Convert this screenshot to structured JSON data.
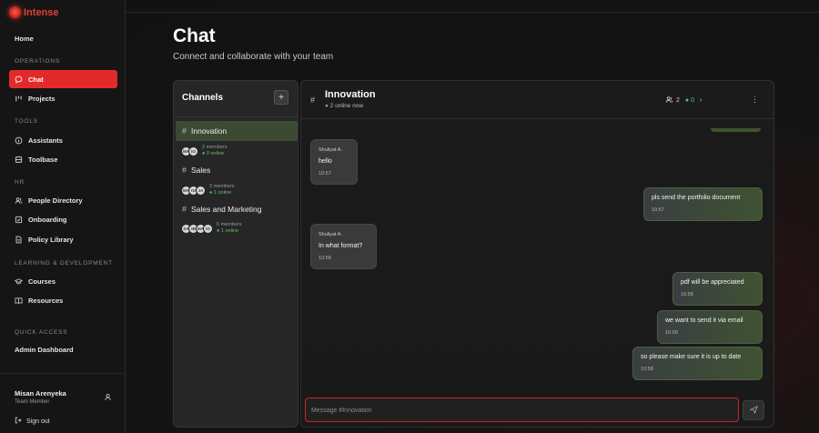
{
  "brand": {
    "name": "Intense"
  },
  "sidebar": {
    "home": "Home",
    "sections": [
      {
        "title": "OPERATIONS",
        "items": [
          {
            "label": "Chat",
            "icon": "chat-bubble-icon"
          },
          {
            "label": "Projects",
            "icon": "kanban-icon"
          }
        ]
      },
      {
        "title": "TOOLS",
        "items": [
          {
            "label": "Assistants",
            "icon": "info-circle-icon"
          },
          {
            "label": "Toolbase",
            "icon": "database-icon"
          }
        ]
      },
      {
        "title": "HR",
        "items": [
          {
            "label": "People Directory",
            "icon": "people-icon"
          },
          {
            "label": "Onboarding",
            "icon": "checkbox-icon"
          },
          {
            "label": "Policy Library",
            "icon": "document-icon"
          }
        ]
      },
      {
        "title": "LEARNING & DEVELOPMENT",
        "items": [
          {
            "label": "Courses",
            "icon": "graduation-cap-icon"
          },
          {
            "label": "Resources",
            "icon": "book-icon"
          }
        ]
      },
      {
        "title": "QUICK ACCESS",
        "items": [
          {
            "label": "Admin Dashboard",
            "icon": ""
          }
        ]
      }
    ],
    "active_item": "Chat",
    "user": {
      "name": "Misan Arenyeka",
      "role": "Team Member"
    },
    "sign_out": "Sign out"
  },
  "page": {
    "title": "Chat",
    "subtitle": "Connect and collaborate with your team"
  },
  "channels": {
    "title": "Channels",
    "add_label": "+",
    "list": [
      {
        "name": "Innovation",
        "members": "2 members",
        "online": "0 online",
        "avatars": [
          "MA",
          "IO"
        ],
        "active": true
      },
      {
        "name": "Sales",
        "members": "3 members",
        "online": "1 online",
        "avatars": [
          "MA",
          "IO",
          "JA"
        ],
        "active": false
      },
      {
        "name": "Sales and Marketing",
        "members": "6 members",
        "online": "1 online",
        "avatars": [
          "SA",
          "IB",
          "MA",
          "IO"
        ],
        "active": false
      }
    ]
  },
  "chat": {
    "channel_name": "Innovation",
    "online_now": "2 online now",
    "member_count": "2",
    "online_count": "0",
    "input_placeholder": "Message #Innovation",
    "messages": [
      {
        "direction": "in",
        "sender": "Shuliyat A.",
        "text": "hello",
        "time": "10:57"
      },
      {
        "direction": "out",
        "sender": "",
        "text": "pls send the portfolio document",
        "time": "10:57"
      },
      {
        "direction": "in",
        "sender": "Shuliyat A.",
        "text": "In what format?",
        "time": "10:58"
      },
      {
        "direction": "out",
        "sender": "",
        "text": "pdf will be appreciated",
        "time": "10:58"
      },
      {
        "direction": "out",
        "sender": "",
        "text": "we want to send it via email",
        "time": "10:58"
      },
      {
        "direction": "out",
        "sender": "",
        "text": "so please make sure it is up to date",
        "time": "10:58"
      }
    ]
  },
  "colors": {
    "accent": "#e32a2a",
    "online": "#58c46a",
    "outgoing_bubble": "#3f5232"
  }
}
